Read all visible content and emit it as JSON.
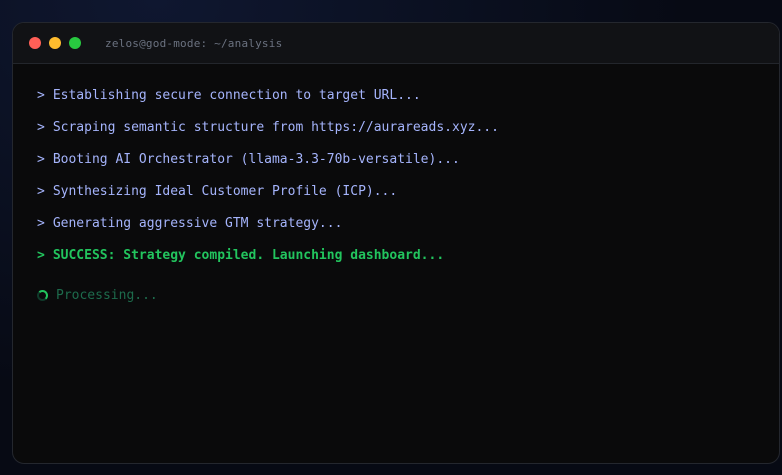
{
  "window": {
    "title": "zelos@god-mode: ~/analysis"
  },
  "terminal": {
    "prompt": ">",
    "lines": [
      {
        "text": "Establishing secure connection to target URL..."
      },
      {
        "text": "Scraping semantic structure from https://aurareads.xyz..."
      },
      {
        "text": "Booting AI Orchestrator (llama-3.3-70b-versatile)..."
      },
      {
        "text": "Synthesizing Ideal Customer Profile (ICP)..."
      },
      {
        "text": "Generating aggressive GTM strategy..."
      },
      {
        "text": "SUCCESS: Strategy compiled. Launching dashboard..."
      }
    ],
    "status": "Processing...",
    "status_icon": "spinner-icon"
  },
  "colors": {
    "line": "#a5b4fc",
    "success": "#22c55e",
    "processing": "#1d6b4c",
    "close": "#ff5f57",
    "minimize": "#febc2e",
    "maximize": "#28c840"
  }
}
